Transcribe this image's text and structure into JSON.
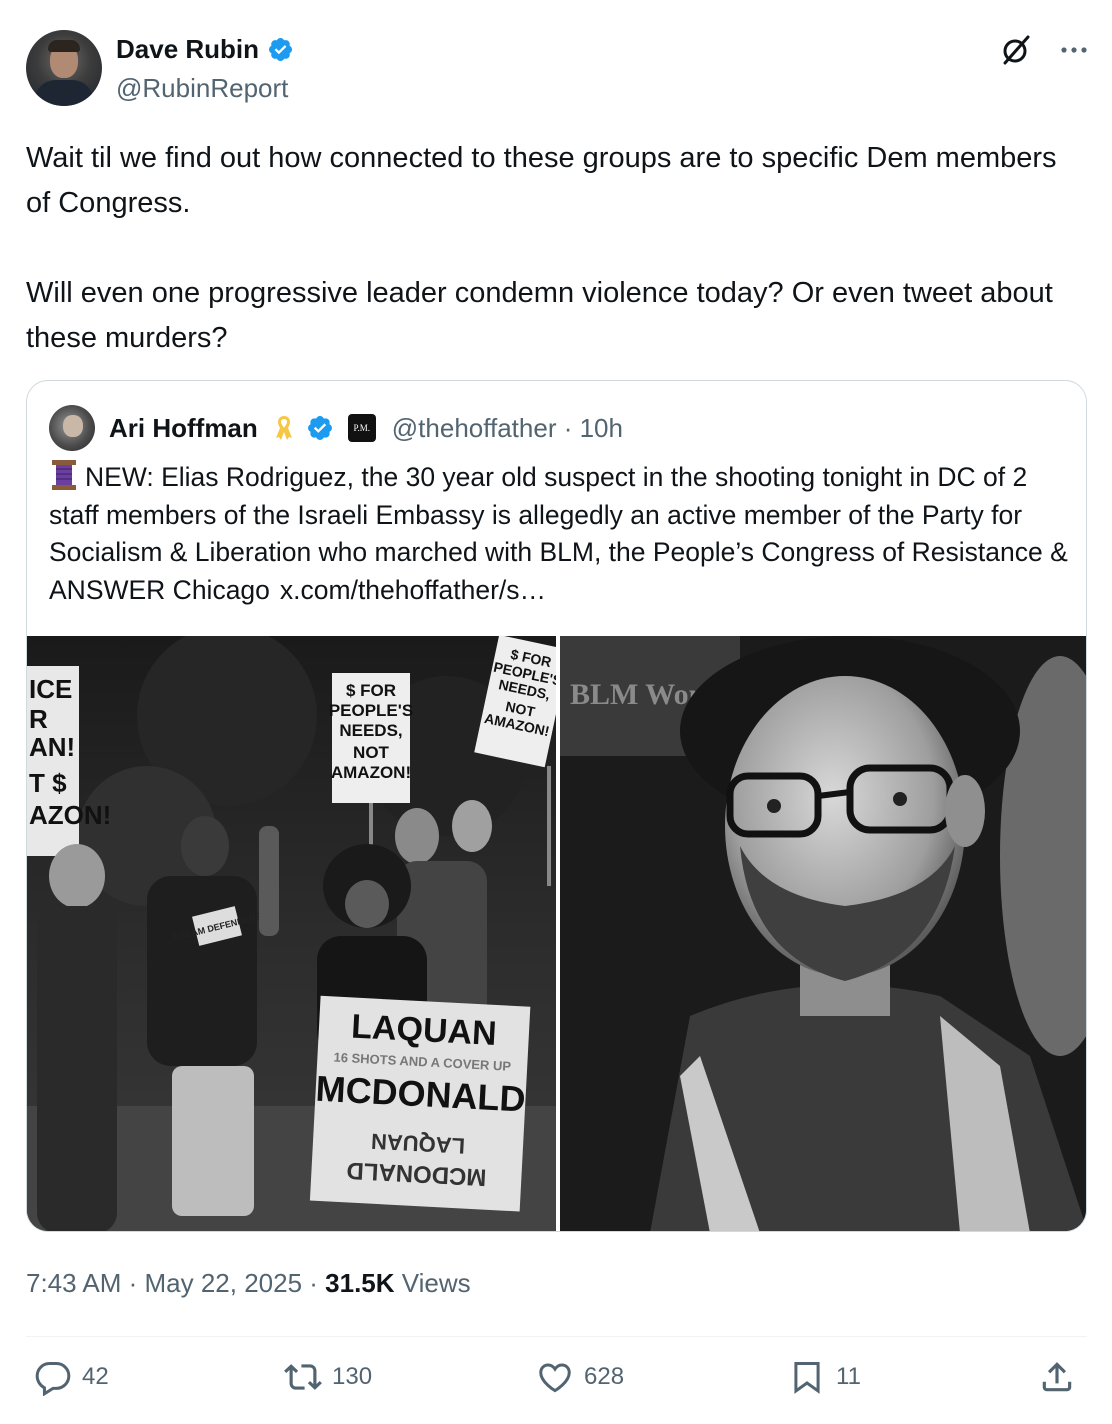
{
  "author": {
    "display_name": "Dave Rubin",
    "handle": "@RubinReport",
    "verified": true
  },
  "tweet": {
    "text": "Wait til we find out how connected to these groups are to specific Dem members of Congress.\n\nWill even one progressive leader condemn violence today? Or even tweet about these murders?"
  },
  "quoted_tweet": {
    "display_name": "Ari Hoffman",
    "badge_label": "P.M.",
    "handle_time": "@thehoffather · 10h",
    "text": "NEW: Elias Rodriguez, the 30 year old suspect in the shooting tonight in DC of 2 staff members of the Israeli Embassy is allegedly an active member of the Party for Socialism & Liberation who marched with BLM, the People’s Congress of Resistance & ANSWER Chicago",
    "link": "x.com/thehoffather/s…",
    "images": [
      {
        "signs": {
          "left_sign": "ICE R AN! T $ AZON!",
          "center_sign": "$ FOR PEOPLE'S NEEDS, NOT AMAZON!",
          "right_sign": "$ FOR PEOPLE'S NEEDS, NOT AMAZON!",
          "bottom_sign_top": "LAQUAN",
          "bottom_sign_middle": "16 SHOTS AND A COVER UP",
          "bottom_sign_bottom": "MCDONALD",
          "shirt": "DREAM DEFENDERS"
        }
      },
      {
        "sign_fragment": "BLM Wom"
      }
    ]
  },
  "meta": {
    "time_date": "7:43 AM · May 22, 2025 · ",
    "views_count": "31.5K",
    "views_label": " Views"
  },
  "actions": {
    "replies": "42",
    "reposts": "130",
    "likes": "628",
    "bookmarks": "11"
  },
  "colors": {
    "verified_blue": "#1d9bf0",
    "text_primary": "#0f1419",
    "text_secondary": "#536471",
    "border": "#cfd9de",
    "ribbon_yellow": "#f6c744",
    "spool_purple": "#6b3fa0"
  },
  "icons": [
    "verified-badge-icon",
    "grok-icon",
    "more-icon",
    "ribbon-icon",
    "pm-badge",
    "spool-icon",
    "reply-icon",
    "repost-icon",
    "like-icon",
    "bookmark-icon",
    "share-icon"
  ]
}
